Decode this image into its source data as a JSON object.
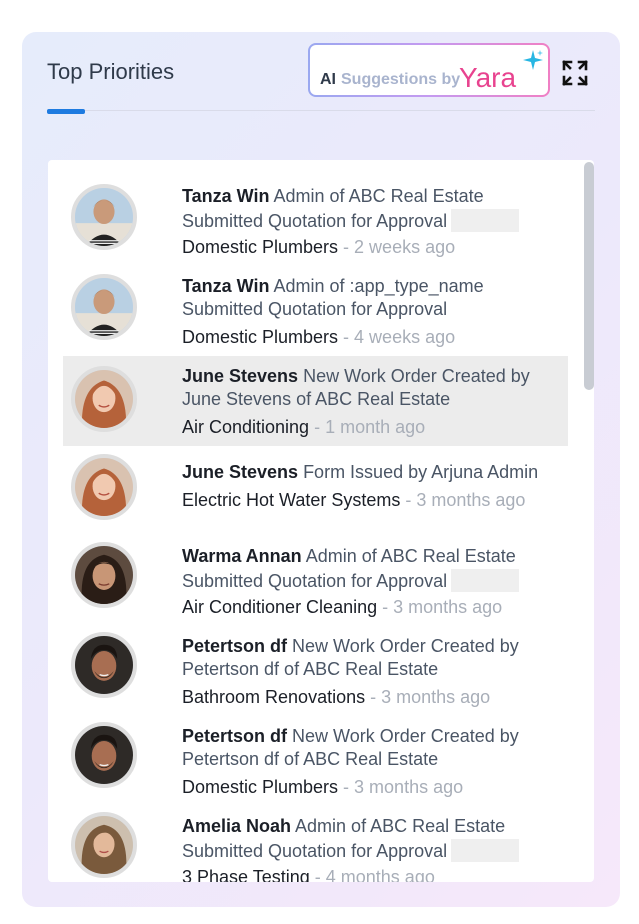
{
  "panel": {
    "title": "Top Priorities",
    "ai_button": {
      "prefix": "AI",
      "label": "Suggestions by",
      "brand": "Yara"
    }
  },
  "items": [
    {
      "name": "Tanza Win",
      "action": " Admin of ABC Real Estate",
      "action2": "Submitted Quotation for Approval",
      "category": "Domestic Plumbers",
      "time": " - 2 weeks ago"
    },
    {
      "name": "Tanza Win",
      "action": " Admin of :app_type_name",
      "action2": "Submitted Quotation for Approval",
      "category": "Domestic Plumbers",
      "time": " - 4 weeks ago"
    },
    {
      "name": "June Stevens",
      "action": " New Work Order Created by",
      "action2": "June Stevens of ABC Real Estate",
      "category": "Air Conditioning",
      "time": " - 1 month ago"
    },
    {
      "name": "June Stevens",
      "action": " Form Issued by Arjuna Admin",
      "category": "Electric Hot Water Systems",
      "time": " - 3 months ago"
    },
    {
      "name": "Warma Annan",
      "action": " Admin of ABC Real Estate",
      "action2": "Submitted Quotation for Approval",
      "category": "Air Conditioner Cleaning",
      "time": " - 3 months ago"
    },
    {
      "name": "Petertson df",
      "action": " New Work Order Created by",
      "action2": "Petertson df of ABC Real Estate",
      "category": "Bathroom Renovations",
      "time": " - 3 months ago"
    },
    {
      "name": "Petertson df",
      "action": " New Work Order Created by",
      "action2": "Petertson df of ABC Real Estate",
      "category": "Domestic Plumbers",
      "time": " - 3 months ago"
    },
    {
      "name": "Amelia Noah",
      "action": " Admin of ABC Real Estate",
      "action2": "Submitted Quotation for Approval",
      "category": "3 Phase Testing",
      "time": " - 4 months ago"
    }
  ],
  "colors": {
    "accent": "#1e7be0",
    "brand": "#e8438f",
    "highlight_row": "#ececec"
  },
  "icons": {
    "expand": "expand-icon",
    "sparkle": "sparkle-icon"
  }
}
